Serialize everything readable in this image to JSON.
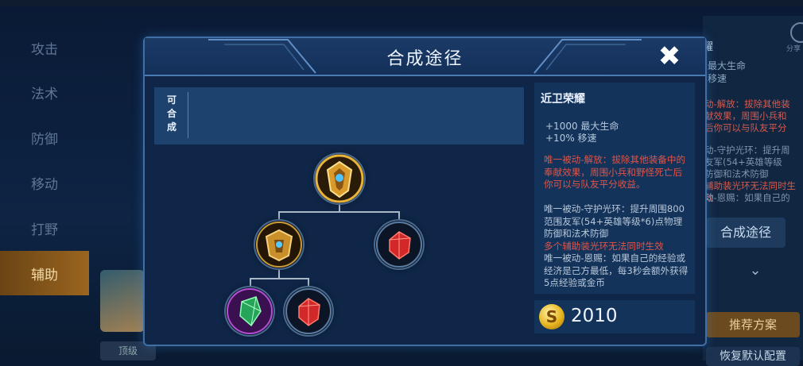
{
  "categories": [
    "攻击",
    "法术",
    "防御",
    "移动",
    "打野",
    "辅助"
  ],
  "active_category": 5,
  "background_panel": {
    "title": "耀",
    "stats": [
      "最大生命",
      "移速"
    ],
    "red_lines": [
      "动-解放：拔除其他装",
      "献效果，周围小兵和",
      "后你可以与队友平分"
    ],
    "grey_lines": [
      "动-守护光环：提升周",
      "友军(54+英雄等级",
      "防御和法术防御"
    ],
    "red_lines_2": [
      "辅助装光环无法同时生效"
    ],
    "grey_lines_2": [
      "动-恩赐：如果自己的"
    ],
    "compose_button": "合成途径",
    "recommend_button": "推荐方案",
    "restore_button": "恢复默认配置",
    "share_label": "分享",
    "bottom_tag": "顶级"
  },
  "dialog": {
    "title": "合成途径",
    "close_icon": "close-icon",
    "craftable_label": "可合成",
    "tree": {
      "root": {
        "name": "近卫荣耀",
        "icon": "golden-shield-icon"
      },
      "children": [
        {
          "name": "component-armor",
          "icon": "golden-armor-icon"
        },
        {
          "name": "ruby",
          "icon": "red-gem-icon"
        }
      ],
      "grandchildren": [
        {
          "name": "emerald",
          "icon": "green-gem-icon"
        },
        {
          "name": "ruby",
          "icon": "red-gem-icon"
        }
      ]
    },
    "info": {
      "item_name": "近卫荣耀",
      "stats": [
        "+1000 最大生命",
        "+10% 移速"
      ],
      "passive_1": "唯一被动-解放：拔除其他装备中的奉献效果，周围小兵和野怪死亡后你可以与队友平分收益。",
      "passive_2": "唯一被动-守护光环：提升周围800范围友军(54+英雄等级*6)点物理防御和法术防御",
      "passive_2_note": "多个辅助装光环无法同时生效",
      "passive_3": "唯一被动-恩赐：如果自己的经验或经济是己方最低，每3秒会额外获得5点经验或金币"
    },
    "price": {
      "icon": "gold-coin-icon",
      "value": "2010"
    }
  },
  "colors": {
    "accent": "#3f6fa4",
    "active_tab": "#9a651f",
    "red_text": "#e15448",
    "gold": "#e6b41f"
  }
}
